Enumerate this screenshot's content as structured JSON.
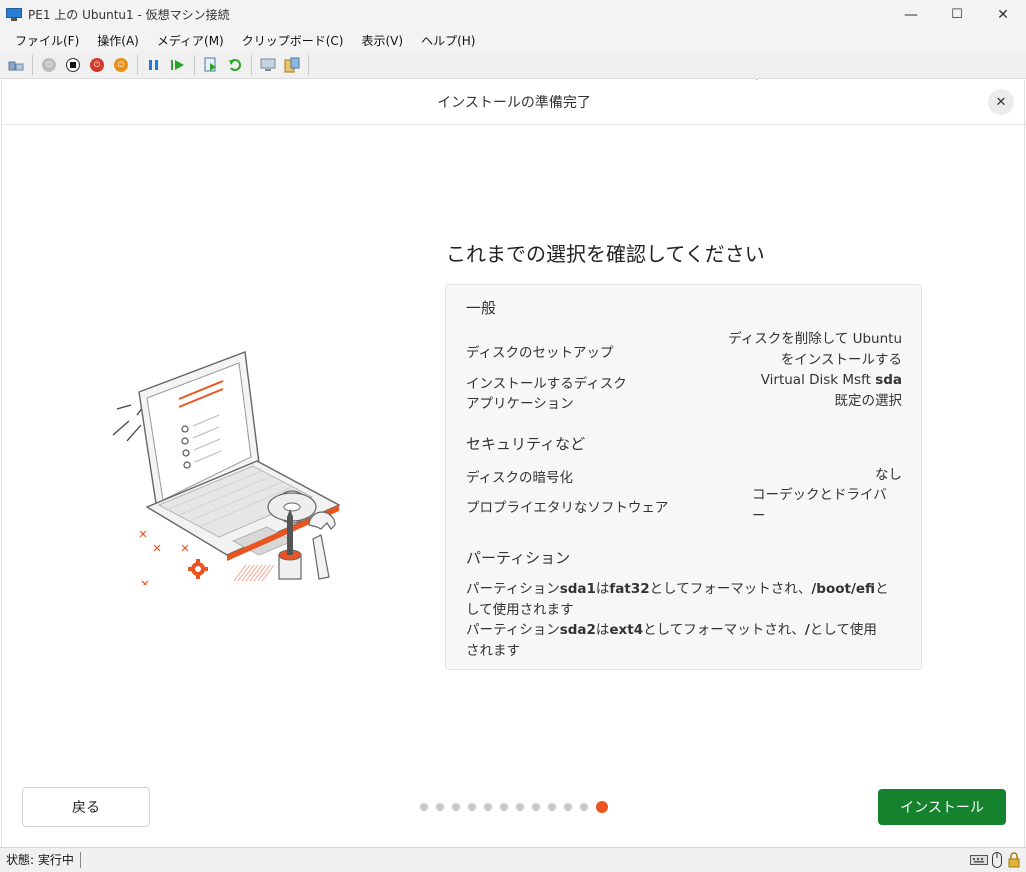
{
  "window": {
    "title": "PE1 上の Ubuntu1 - 仮想マシン接続",
    "minimize": "—",
    "maximize": "☐",
    "close": "✕"
  },
  "menubar": {
    "items": [
      "ファイル(F)",
      "操作(A)",
      "メディア(M)",
      "クリップボード(C)",
      "表示(V)",
      "ヘルプ(H)"
    ]
  },
  "installer": {
    "header_title": "インストールの準備完了",
    "close_label": "✕",
    "heading": "これまでの選択を確認してください",
    "general": {
      "title": "一般",
      "disk_setup_label": "ディスクのセットアップ",
      "disk_setup_value_1": "ディスクを削除して Ubuntu",
      "disk_setup_value_2": "をインストールする",
      "install_disk_label": "インストールするディスク",
      "install_disk_value": "Virtual Disk Msft",
      "install_disk_device": "sda",
      "applications_label": "アプリケーション",
      "applications_value": "既定の選択"
    },
    "security": {
      "title": "セキュリティなど",
      "encryption_label": "ディスクの暗号化",
      "encryption_value": "なし",
      "proprietary_label": "プロプライエタリなソフトウェア",
      "proprietary_value_1": "コーデックとドライバ",
      "proprietary_value_2": "ー"
    },
    "partitions": {
      "title": "パーティション",
      "line1": {
        "p1": "パーティション",
        "dev": "sda1",
        "p2": "は",
        "fs": "fat32",
        "p3": "としてフォーマットされ、",
        "mount": "/boot/efi",
        "p4": "と",
        "p5": "して使用されます"
      },
      "line2": {
        "p1": "パーティション",
        "dev": "sda2",
        "p2": "は",
        "fs": "ext4",
        "p3": "としてフォーマットされ、",
        "mount": "/",
        "p4": "として使用",
        "p5": "されます"
      }
    },
    "back_label": "戻る",
    "install_label": "インストール",
    "progress": {
      "total_steps": 12,
      "current_step": 12
    }
  },
  "statusbar": {
    "text": "状態: 実行中"
  },
  "colors": {
    "accent": "#e95420",
    "install_green": "#15822e"
  }
}
